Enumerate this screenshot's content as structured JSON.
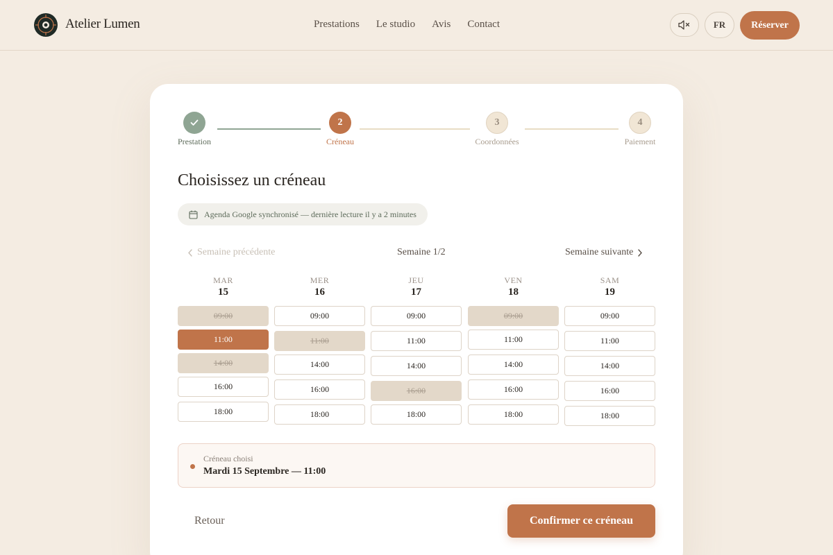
{
  "brand": {
    "name": "Atelier Lumen"
  },
  "nav": [
    "Prestations",
    "Le studio",
    "Avis",
    "Contact"
  ],
  "header": {
    "lang": "FR",
    "reserve_label": "Réserver",
    "mute_icon": "speaker-muted-icon"
  },
  "colors": {
    "accent": "#c0744a",
    "done": "#8fa593",
    "background": "#f4ece2",
    "taken": "#e3d8c9"
  },
  "steps": [
    {
      "label": "Prestation",
      "number": "",
      "state": "done"
    },
    {
      "label": "Créneau",
      "number": "2",
      "state": "active"
    },
    {
      "label": "Coordonnées",
      "number": "3",
      "state": "pending"
    },
    {
      "label": "Paiement",
      "number": "4",
      "state": "pending"
    }
  ],
  "page": {
    "title": "Choisissez un créneau"
  },
  "sync": {
    "text": "Agenda Google synchronisé — dernière lecture il y a 2 minutes",
    "icon": "calendar-icon"
  },
  "week_nav": {
    "prev": "Semaine précédente",
    "label": "Semaine 1/2",
    "next": "Semaine suivante"
  },
  "days": [
    {
      "name": "MAR",
      "num": "15",
      "slots": [
        {
          "time": "09:00",
          "state": "taken"
        },
        {
          "time": "11:00",
          "state": "selected"
        },
        {
          "time": "14:00",
          "state": "taken"
        },
        {
          "time": "16:00",
          "state": "free"
        },
        {
          "time": "18:00",
          "state": "free"
        }
      ]
    },
    {
      "name": "MER",
      "num": "16",
      "slots": [
        {
          "time": "09:00",
          "state": "free"
        },
        {
          "time": "11:00",
          "state": "taken"
        },
        {
          "time": "14:00",
          "state": "free"
        },
        {
          "time": "16:00",
          "state": "free"
        },
        {
          "time": "18:00",
          "state": "free"
        }
      ]
    },
    {
      "name": "JEU",
      "num": "17",
      "slots": [
        {
          "time": "09:00",
          "state": "free"
        },
        {
          "time": "11:00",
          "state": "free"
        },
        {
          "time": "14:00",
          "state": "free"
        },
        {
          "time": "16:00",
          "state": "taken"
        },
        {
          "time": "18:00",
          "state": "free"
        }
      ]
    },
    {
      "name": "VEN",
      "num": "18",
      "slots": [
        {
          "time": "09:00",
          "state": "taken"
        },
        {
          "time": "11:00",
          "state": "free"
        },
        {
          "time": "14:00",
          "state": "free"
        },
        {
          "time": "16:00",
          "state": "free"
        },
        {
          "time": "18:00",
          "state": "free"
        }
      ]
    },
    {
      "name": "SAM",
      "num": "19",
      "slots": [
        {
          "time": "09:00",
          "state": "free"
        },
        {
          "time": "11:00",
          "state": "free"
        },
        {
          "time": "14:00",
          "state": "free"
        },
        {
          "time": "16:00",
          "state": "free"
        },
        {
          "time": "18:00",
          "state": "free"
        }
      ]
    }
  ],
  "chosen": {
    "label": "Créneau choisi",
    "value": "Mardi 15 Septembre — 11:00"
  },
  "actions": {
    "back": "Retour",
    "confirm": "Confirmer ce créneau"
  }
}
